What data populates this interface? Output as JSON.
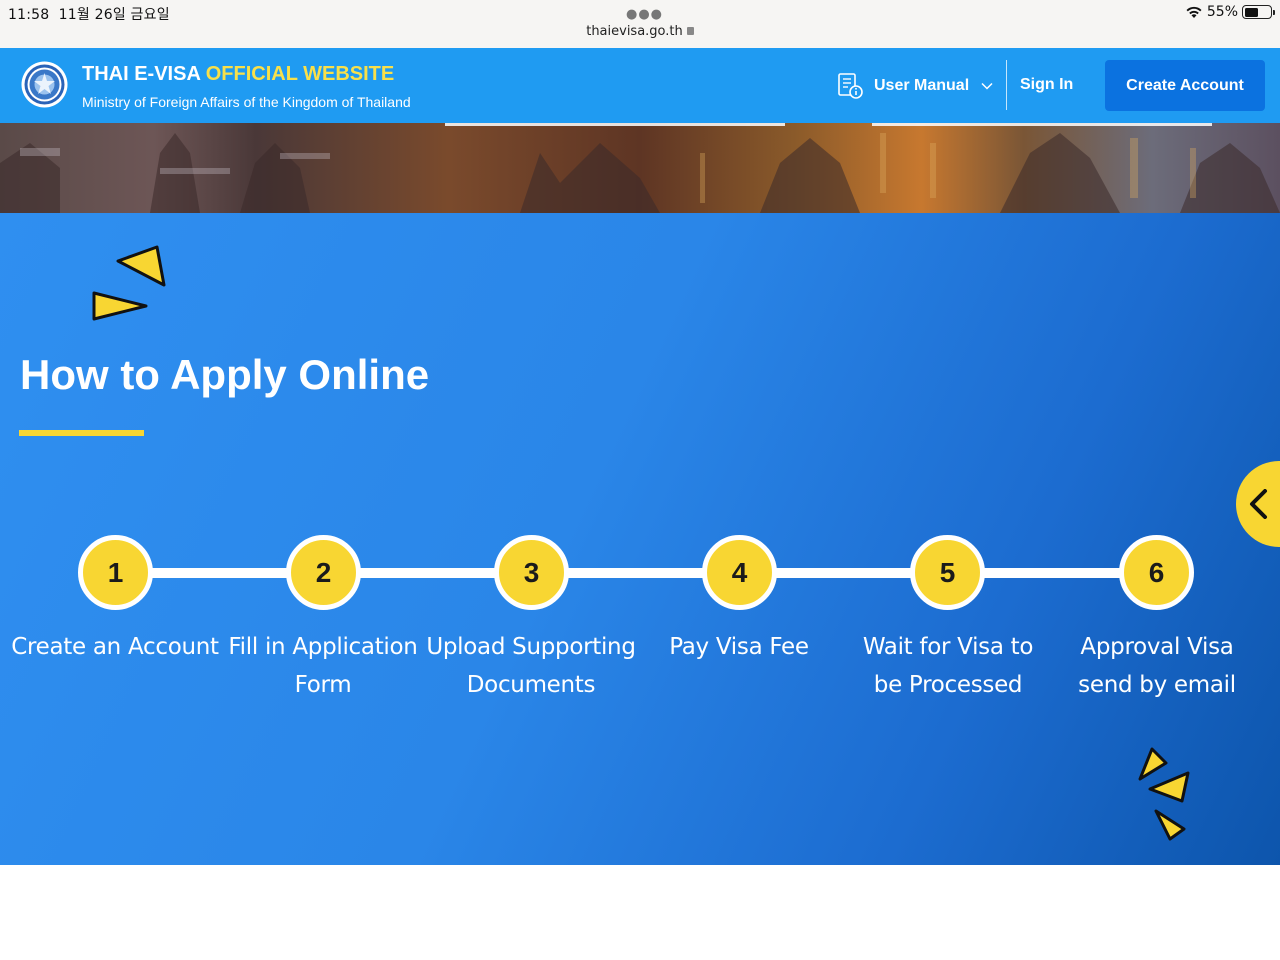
{
  "status_bar": {
    "time": "11:58",
    "date": "11월 26일 금요일",
    "url": "thaievisa.go.th",
    "battery": "55%",
    "battery_level": 0.55
  },
  "header": {
    "title_main": "THAI E-VISA",
    "title_highlight": "OFFICIAL WEBSITE",
    "subtitle": "Ministry of Foreign Affairs of the Kingdom of Thailand",
    "nav": {
      "user_manual": "User Manual",
      "sign_in": "Sign In",
      "create_account": "Create Account"
    }
  },
  "how_to_apply": {
    "title": "How to Apply Online",
    "steps": [
      {
        "number": "1",
        "label": "Create an Account"
      },
      {
        "number": "2",
        "label": "Fill in Application Form"
      },
      {
        "number": "3",
        "label": "Upload Supporting Documents"
      },
      {
        "number": "4",
        "label": "Pay Visa Fee"
      },
      {
        "number": "5",
        "label": "Wait for Visa to be Processed"
      },
      {
        "number": "6",
        "label": "Approval Visa send by email"
      }
    ]
  },
  "colors": {
    "header_blue": "#1f9bf2",
    "accent_yellow": "#f8d632",
    "button_blue": "#0b72e0"
  },
  "icons": {
    "manual": "document-info-icon",
    "dropdown": "chevron-down-icon",
    "side_tab": "chevron-left-icon"
  }
}
